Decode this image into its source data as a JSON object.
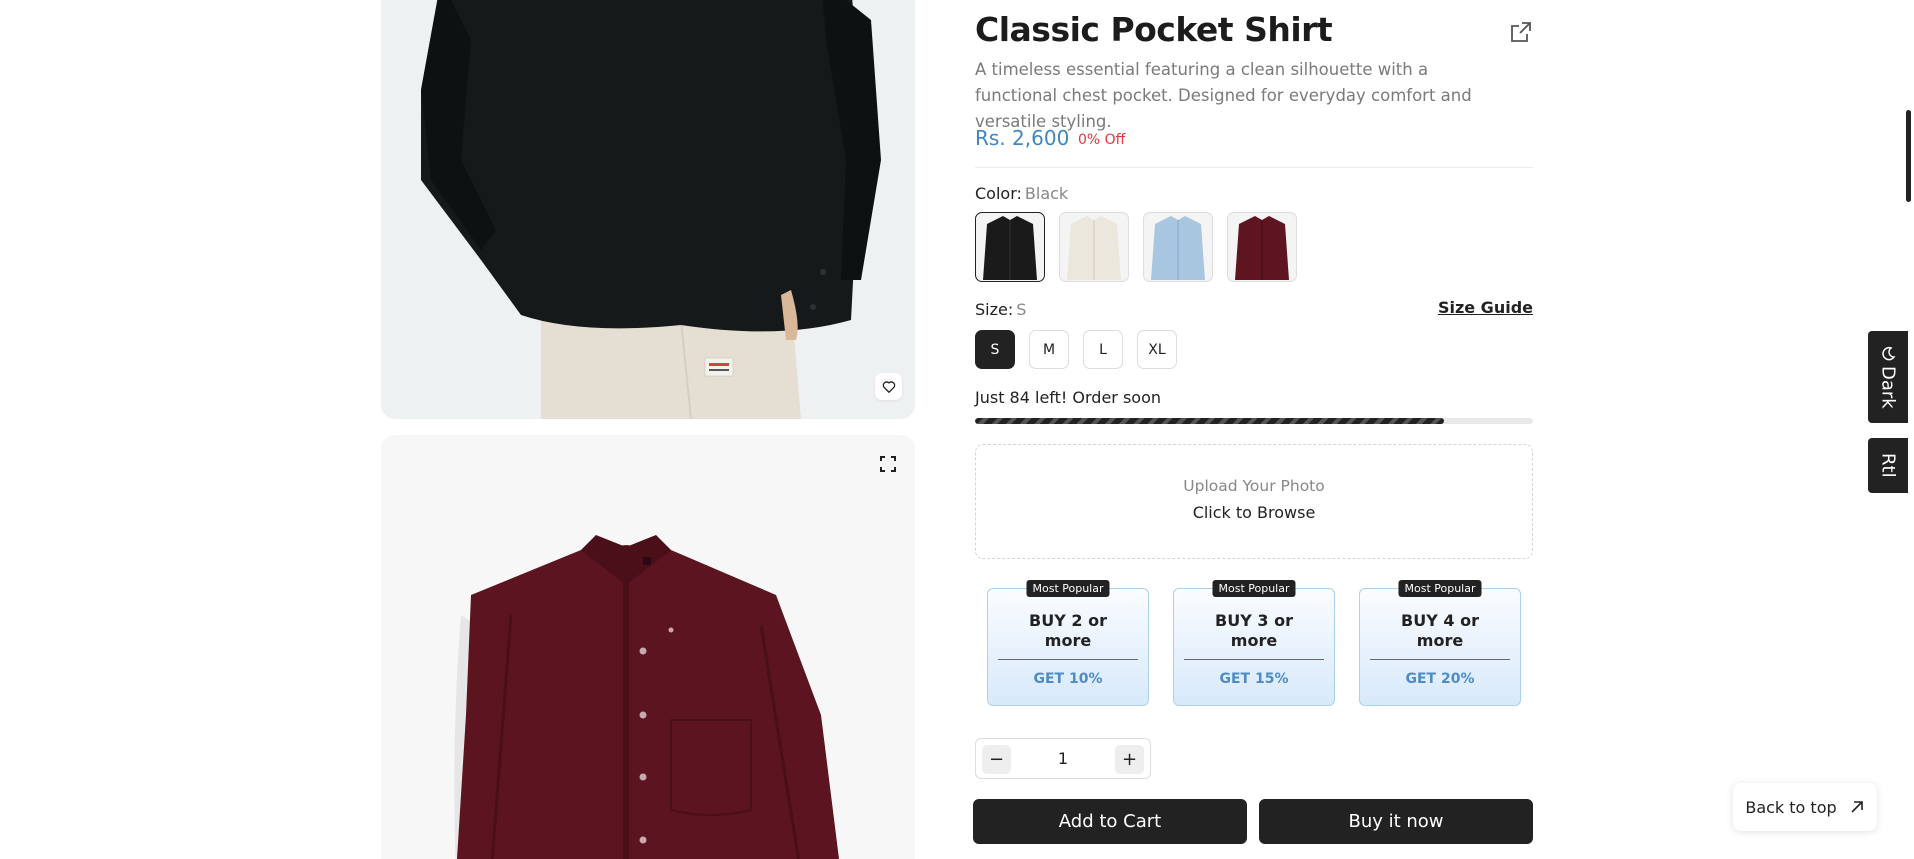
{
  "product": {
    "title": "Classic Pocket Shirt",
    "description": "A timeless essential featuring a clean silhouette with a functional chest pocket. Designed for everyday comfort and versatile styling.",
    "price": "Rs. 2,600",
    "discount": "0% Off"
  },
  "color": {
    "label": "Color:",
    "selected": "Black",
    "swatches": [
      {
        "name": "Black",
        "hex": "#1a1a1a"
      },
      {
        "name": "Cream",
        "hex": "#ebe7dc"
      },
      {
        "name": "Light Blue",
        "hex": "#a8c6e0"
      },
      {
        "name": "Burgundy",
        "hex": "#5e1521"
      }
    ]
  },
  "size": {
    "label": "Size:",
    "selected": "S",
    "guide_label": "Size Guide",
    "options": [
      "S",
      "M",
      "L",
      "XL"
    ]
  },
  "stock": {
    "text": "Just 84 left! Order soon",
    "fill_percent": 84
  },
  "upload": {
    "title": "Upload Your Photo",
    "action": "Click to Browse"
  },
  "bundles": [
    {
      "tag": "Most Popular",
      "buy": "BUY 2 or more",
      "get": "GET 10%"
    },
    {
      "tag": "Most Popular",
      "buy": "BUY 3 or more",
      "get": "GET 15%"
    },
    {
      "tag": "Most Popular",
      "buy": "BUY 4 or more",
      "get": "GET 20%"
    }
  ],
  "quantity": {
    "value": "1",
    "minus": "−",
    "plus": "+"
  },
  "actions": {
    "add_to_cart": "Add to Cart",
    "buy_now": "Buy it now"
  },
  "side": {
    "dark_label": "Dark",
    "rtl_label": "Rtl"
  },
  "back_to_top": "Back to top",
  "colors": {
    "accent_price": "#3f86c3",
    "discount_red": "#e0383a",
    "primary_dark": "#222222"
  }
}
